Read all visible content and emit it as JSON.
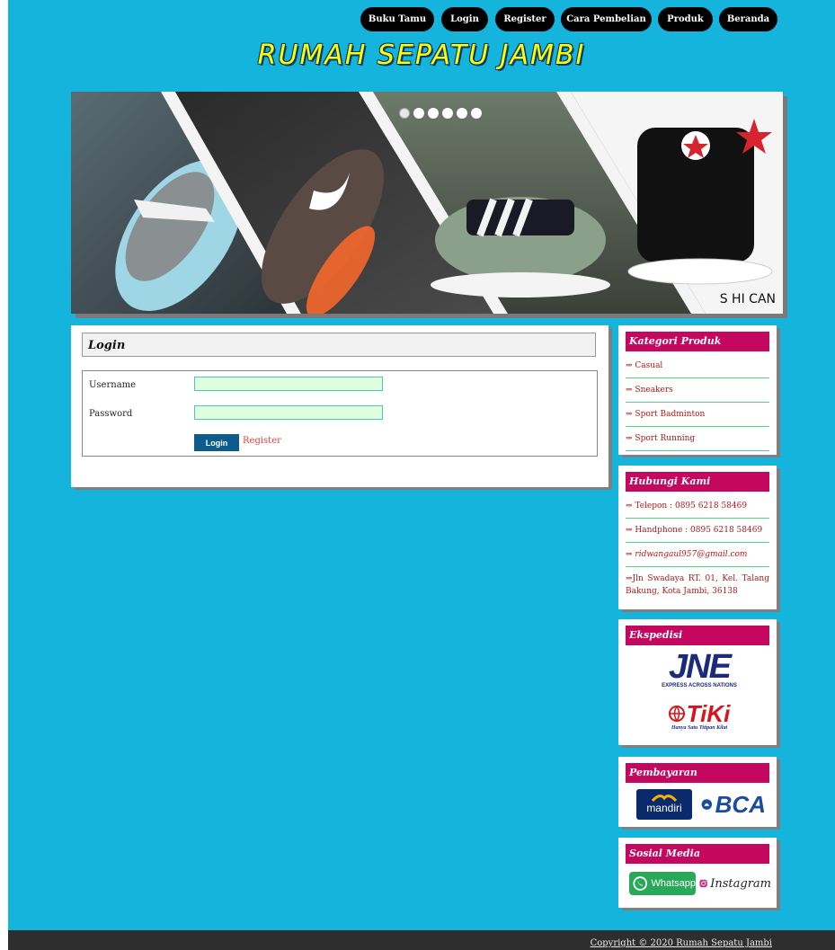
{
  "nav": {
    "items": [
      "Buku Tamu",
      "Login",
      "Register",
      "Cara Pembelian",
      "Produk",
      "Beranda"
    ]
  },
  "site": {
    "title": "RUMAH SEPATU JAMBI"
  },
  "banner": {
    "caption": "S HI CAN",
    "slide_count": 6,
    "active_slide": 1
  },
  "login": {
    "title": "Login",
    "username_label": "Username",
    "password_label": "Password",
    "username_value": "",
    "password_value": "",
    "login_button": "Login",
    "register_link": "Register"
  },
  "sidebar": {
    "kategori": {
      "title": "Kategori Produk",
      "items": [
        "⇒ Casual",
        "⇒ Sneakers",
        "⇒ Sport Badminton",
        "⇒ Sport Running"
      ]
    },
    "hubungi": {
      "title": "Hubungi Kami",
      "telepon": "⇒ Telepon : 0895 6218 58469",
      "handphone": "⇒ Handphone : 0895 6218 58469",
      "email": "⇒ ridwangaul957@gmail.com",
      "alamat": "⇒Jln Swadaya RT. 01, Kel. Talang Bakung, Kota Jambi, 36138"
    },
    "ekspedisi": {
      "title": "Ekspedisi",
      "jne_logo": "JNE",
      "jne_tagline": "EXPRESS ACROSS NATIONS",
      "tiki_logo": "TiKi",
      "tiki_tagline": "Hanya Satu Titipan Kilat"
    },
    "pembayaran": {
      "title": "Pembayaran",
      "mandiri_logo": "mandiri",
      "bca_logo": "BCA"
    },
    "sosial": {
      "title": "Sosial Media",
      "whatsapp": "Whatsapp",
      "instagram": "Instagram"
    }
  },
  "footer": {
    "copyright": "Copyright © 2020 Rumah Sepatu Jambi"
  },
  "colors": {
    "page_bg": "#14b4dd",
    "nav_pill": "#000000",
    "title_yellow": "#ffff00",
    "sidebar_head": "#c5085f",
    "login_button": "#0d5c8c",
    "link_red": "#b01818",
    "footer_bg": "#2e2e2e"
  }
}
